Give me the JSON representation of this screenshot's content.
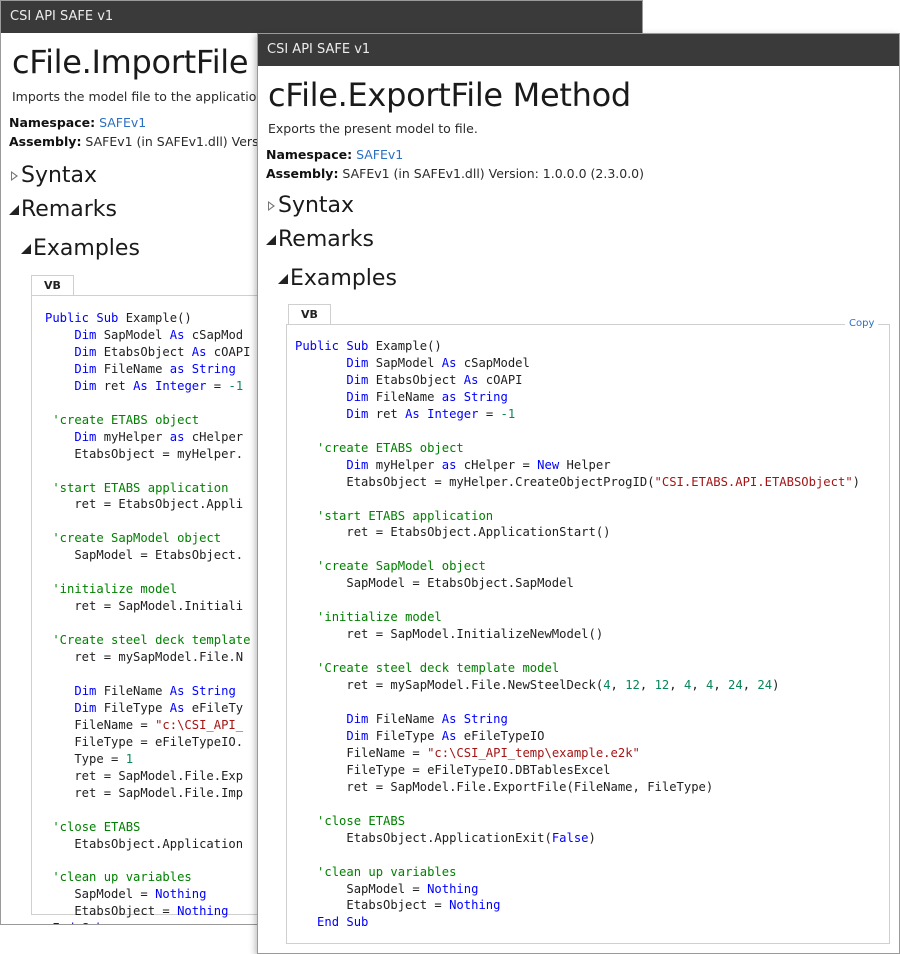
{
  "back_window": {
    "title": "CSI API SAFE v1",
    "heading": "cFile.ImportFile",
    "summary": "Imports the model file to the applicatio",
    "namespace_label": "Namespace:",
    "namespace_value": "SAFEv1",
    "assembly_label": "Assembly:",
    "assembly_value": "SAFEv1 (in SAFEv1.dll) Versi",
    "sections": {
      "syntax": "Syntax",
      "remarks": "Remarks",
      "examples": "Examples"
    },
    "tab_label": "VB",
    "code_lines": [
      [
        [
          "kw",
          "Public Sub"
        ],
        [
          "tx",
          " Example()"
        ]
      ],
      [
        [
          "tx",
          "    "
        ],
        [
          "kw",
          "Dim"
        ],
        [
          "tx",
          " SapModel "
        ],
        [
          "kw",
          "As"
        ],
        [
          "tx",
          " cSapMod"
        ]
      ],
      [
        [
          "tx",
          "    "
        ],
        [
          "kw",
          "Dim"
        ],
        [
          "tx",
          " EtabsObject "
        ],
        [
          "kw",
          "As"
        ],
        [
          "tx",
          " cOAPI"
        ]
      ],
      [
        [
          "tx",
          "    "
        ],
        [
          "kw",
          "Dim"
        ],
        [
          "tx",
          " FileName "
        ],
        [
          "kw",
          "as"
        ],
        [
          "tx",
          " "
        ],
        [
          "kw",
          "String"
        ]
      ],
      [
        [
          "tx",
          "    "
        ],
        [
          "kw",
          "Dim"
        ],
        [
          "tx",
          " ret "
        ],
        [
          "kw",
          "As"
        ],
        [
          "tx",
          " "
        ],
        [
          "kw",
          "Integer"
        ],
        [
          "tx",
          " = "
        ],
        [
          "nm",
          "-1"
        ]
      ],
      [
        [
          "tx",
          ""
        ]
      ],
      [
        [
          "tx",
          " "
        ],
        [
          "cm",
          "'create ETABS object"
        ]
      ],
      [
        [
          "tx",
          "    "
        ],
        [
          "kw",
          "Dim"
        ],
        [
          "tx",
          " myHelper "
        ],
        [
          "kw",
          "as"
        ],
        [
          "tx",
          " cHelper"
        ]
      ],
      [
        [
          "tx",
          "    EtabsObject = myHelper."
        ]
      ],
      [
        [
          "tx",
          ""
        ]
      ],
      [
        [
          "tx",
          " "
        ],
        [
          "cm",
          "'start ETABS application"
        ]
      ],
      [
        [
          "tx",
          "    ret = EtabsObject.Appli"
        ]
      ],
      [
        [
          "tx",
          ""
        ]
      ],
      [
        [
          "tx",
          " "
        ],
        [
          "cm",
          "'create SapModel object"
        ]
      ],
      [
        [
          "tx",
          "    SapModel = EtabsObject."
        ]
      ],
      [
        [
          "tx",
          ""
        ]
      ],
      [
        [
          "tx",
          " "
        ],
        [
          "cm",
          "'initialize model"
        ]
      ],
      [
        [
          "tx",
          "    ret = SapModel.Initiali"
        ]
      ],
      [
        [
          "tx",
          ""
        ]
      ],
      [
        [
          "tx",
          " "
        ],
        [
          "cm",
          "'Create steel deck template"
        ]
      ],
      [
        [
          "tx",
          "    ret = mySapModel.File.N"
        ]
      ],
      [
        [
          "tx",
          ""
        ]
      ],
      [
        [
          "tx",
          "    "
        ],
        [
          "kw",
          "Dim"
        ],
        [
          "tx",
          " FileName "
        ],
        [
          "kw",
          "As"
        ],
        [
          "tx",
          " "
        ],
        [
          "kw",
          "String"
        ]
      ],
      [
        [
          "tx",
          "    "
        ],
        [
          "kw",
          "Dim"
        ],
        [
          "tx",
          " FileType "
        ],
        [
          "kw",
          "As"
        ],
        [
          "tx",
          " eFileTy"
        ]
      ],
      [
        [
          "tx",
          "    FileName = "
        ],
        [
          "st",
          "\"c:\\CSI_API_"
        ]
      ],
      [
        [
          "tx",
          "    FileType = eFileTypeIO."
        ]
      ],
      [
        [
          "tx",
          "    Type = "
        ],
        [
          "nm",
          "1"
        ]
      ],
      [
        [
          "tx",
          "    ret = SapModel.File.Exp"
        ]
      ],
      [
        [
          "tx",
          "    ret = SapModel.File.Imp"
        ]
      ],
      [
        [
          "tx",
          ""
        ]
      ],
      [
        [
          "tx",
          " "
        ],
        [
          "cm",
          "'close ETABS"
        ]
      ],
      [
        [
          "tx",
          "    EtabsObject.Application"
        ]
      ],
      [
        [
          "tx",
          ""
        ]
      ],
      [
        [
          "tx",
          " "
        ],
        [
          "cm",
          "'clean up variables"
        ]
      ],
      [
        [
          "tx",
          "    SapModel = "
        ],
        [
          "kw",
          "Nothing"
        ]
      ],
      [
        [
          "tx",
          "    EtabsObject = "
        ],
        [
          "kw",
          "Nothing"
        ]
      ],
      [
        [
          "tx",
          " "
        ],
        [
          "kw",
          "End Sub"
        ]
      ]
    ]
  },
  "front_window": {
    "title": "CSI API SAFE v1",
    "heading": "cFile.ExportFile Method",
    "summary": "Exports the present model to file.",
    "namespace_label": "Namespace:",
    "namespace_value": "SAFEv1",
    "assembly_label": "Assembly:",
    "assembly_value": "SAFEv1 (in SAFEv1.dll) Version: 1.0.0.0 (2.3.0.0)",
    "sections": {
      "syntax": "Syntax",
      "remarks": "Remarks",
      "examples": "Examples"
    },
    "tab_label": "VB",
    "copy_label": "Copy",
    "code_lines": [
      [
        [
          "kw",
          "Public Sub"
        ],
        [
          "tx",
          " Example()"
        ]
      ],
      [
        [
          "tx",
          "       "
        ],
        [
          "kw",
          "Dim"
        ],
        [
          "tx",
          " SapModel "
        ],
        [
          "kw",
          "As"
        ],
        [
          "tx",
          " cSapModel"
        ]
      ],
      [
        [
          "tx",
          "       "
        ],
        [
          "kw",
          "Dim"
        ],
        [
          "tx",
          " EtabsObject "
        ],
        [
          "kw",
          "As"
        ],
        [
          "tx",
          " cOAPI"
        ]
      ],
      [
        [
          "tx",
          "       "
        ],
        [
          "kw",
          "Dim"
        ],
        [
          "tx",
          " FileName "
        ],
        [
          "kw",
          "as"
        ],
        [
          "tx",
          " "
        ],
        [
          "kw",
          "String"
        ]
      ],
      [
        [
          "tx",
          "       "
        ],
        [
          "kw",
          "Dim"
        ],
        [
          "tx",
          " ret "
        ],
        [
          "kw",
          "As"
        ],
        [
          "tx",
          " "
        ],
        [
          "kw",
          "Integer"
        ],
        [
          "tx",
          " = "
        ],
        [
          "nm",
          "-1"
        ]
      ],
      [
        [
          "tx",
          ""
        ]
      ],
      [
        [
          "tx",
          "   "
        ],
        [
          "cm",
          "'create ETABS object"
        ]
      ],
      [
        [
          "tx",
          "       "
        ],
        [
          "kw",
          "Dim"
        ],
        [
          "tx",
          " myHelper "
        ],
        [
          "kw",
          "as"
        ],
        [
          "tx",
          " cHelper = "
        ],
        [
          "kw",
          "New"
        ],
        [
          "tx",
          " Helper"
        ]
      ],
      [
        [
          "tx",
          "       EtabsObject = myHelper.CreateObjectProgID("
        ],
        [
          "st",
          "\"CSI.ETABS.API.ETABSObject\""
        ],
        [
          "tx",
          ")"
        ]
      ],
      [
        [
          "tx",
          ""
        ]
      ],
      [
        [
          "tx",
          "   "
        ],
        [
          "cm",
          "'start ETABS application"
        ]
      ],
      [
        [
          "tx",
          "       ret = EtabsObject.ApplicationStart()"
        ]
      ],
      [
        [
          "tx",
          ""
        ]
      ],
      [
        [
          "tx",
          "   "
        ],
        [
          "cm",
          "'create SapModel object"
        ]
      ],
      [
        [
          "tx",
          "       SapModel = EtabsObject.SapModel"
        ]
      ],
      [
        [
          "tx",
          ""
        ]
      ],
      [
        [
          "tx",
          "   "
        ],
        [
          "cm",
          "'initialize model"
        ]
      ],
      [
        [
          "tx",
          "       ret = SapModel.InitializeNewModel()"
        ]
      ],
      [
        [
          "tx",
          ""
        ]
      ],
      [
        [
          "tx",
          "   "
        ],
        [
          "cm",
          "'Create steel deck template model"
        ]
      ],
      [
        [
          "tx",
          "       ret = mySapModel.File.NewSteelDeck("
        ],
        [
          "nm",
          "4"
        ],
        [
          "tx",
          ", "
        ],
        [
          "nm",
          "12"
        ],
        [
          "tx",
          ", "
        ],
        [
          "nm",
          "12"
        ],
        [
          "tx",
          ", "
        ],
        [
          "nm",
          "4"
        ],
        [
          "tx",
          ", "
        ],
        [
          "nm",
          "4"
        ],
        [
          "tx",
          ", "
        ],
        [
          "nm",
          "24"
        ],
        [
          "tx",
          ", "
        ],
        [
          "nm",
          "24"
        ],
        [
          "tx",
          ")"
        ]
      ],
      [
        [
          "tx",
          ""
        ]
      ],
      [
        [
          "tx",
          "       "
        ],
        [
          "kw",
          "Dim"
        ],
        [
          "tx",
          " FileName "
        ],
        [
          "kw",
          "As"
        ],
        [
          "tx",
          " "
        ],
        [
          "kw",
          "String"
        ]
      ],
      [
        [
          "tx",
          "       "
        ],
        [
          "kw",
          "Dim"
        ],
        [
          "tx",
          " FileType "
        ],
        [
          "kw",
          "As"
        ],
        [
          "tx",
          " eFileTypeIO"
        ]
      ],
      [
        [
          "tx",
          "       FileName = "
        ],
        [
          "st",
          "\"c:\\CSI_API_temp\\example.e2k\""
        ]
      ],
      [
        [
          "tx",
          "       FileType = eFileTypeIO.DBTablesExcel"
        ]
      ],
      [
        [
          "tx",
          "       ret = SapModel.File.ExportFile(FileName, FileType)"
        ]
      ],
      [
        [
          "tx",
          ""
        ]
      ],
      [
        [
          "tx",
          "   "
        ],
        [
          "cm",
          "'close ETABS"
        ]
      ],
      [
        [
          "tx",
          "       EtabsObject.ApplicationExit("
        ],
        [
          "kw",
          "False"
        ],
        [
          "tx",
          ")"
        ]
      ],
      [
        [
          "tx",
          ""
        ]
      ],
      [
        [
          "tx",
          "   "
        ],
        [
          "cm",
          "'clean up variables"
        ]
      ],
      [
        [
          "tx",
          "       SapModel = "
        ],
        [
          "kw",
          "Nothing"
        ]
      ],
      [
        [
          "tx",
          "       EtabsObject = "
        ],
        [
          "kw",
          "Nothing"
        ]
      ],
      [
        [
          "tx",
          "   "
        ],
        [
          "kw",
          "End Sub"
        ]
      ]
    ]
  }
}
